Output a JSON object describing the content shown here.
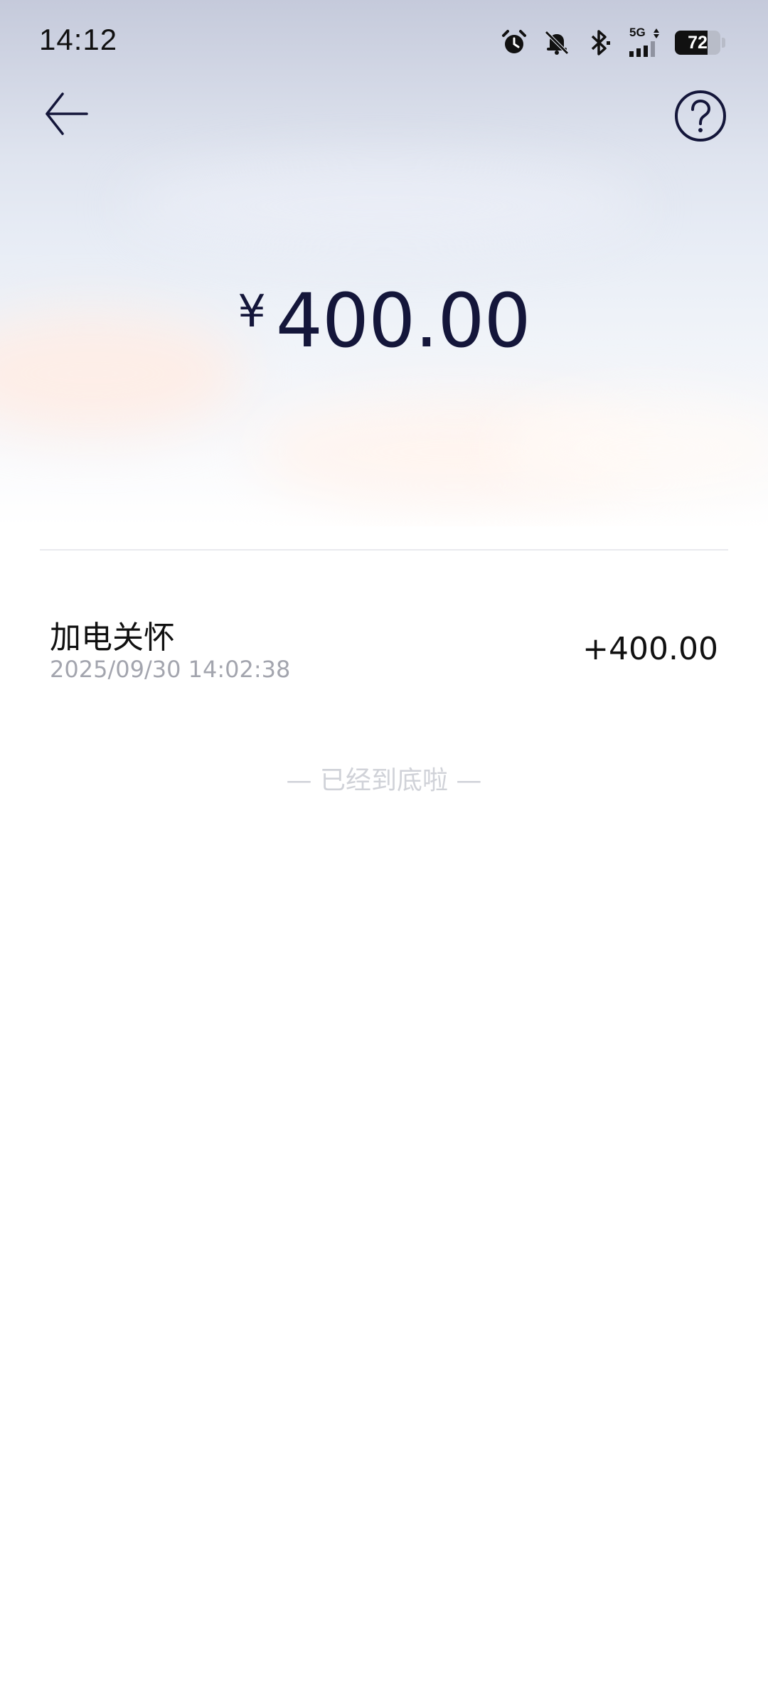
{
  "status_bar": {
    "time": "14:12",
    "network": "5G",
    "battery_level": "72",
    "icons": [
      "alarm-icon",
      "mute-icon",
      "bluetooth-icon",
      "cellular-signal-icon",
      "battery-icon"
    ]
  },
  "nav": {
    "back_icon": "arrow-left-icon",
    "help_icon": "question-circle-icon"
  },
  "balance": {
    "currency_symbol": "¥",
    "amount": "400.00"
  },
  "records": [
    {
      "title": "加电关怀",
      "time": "2025/09/30 14:02:38",
      "value": "+400.00"
    }
  ],
  "end_hint": "— 已经到底啦 —",
  "colors": {
    "primary_text": "#14163a",
    "secondary_text": "#a3a5ae",
    "hint_text": "#d0d2d8",
    "divider": "#e9eaee"
  }
}
